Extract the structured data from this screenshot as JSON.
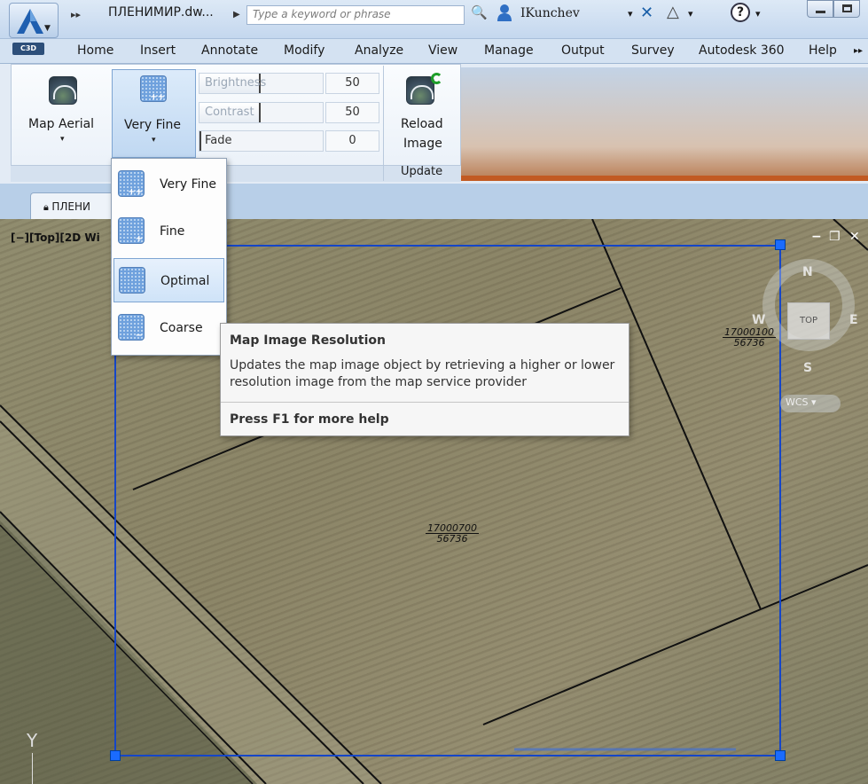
{
  "titlebar": {
    "app_badge": "C3D",
    "file_title": "ПЛЕНИМИР.dw...",
    "search_placeholder": "Type a keyword or phrase",
    "user_name": "IKunchev"
  },
  "ribbon_tabs": [
    "Home",
    "Insert",
    "Annotate",
    "Modify",
    "Analyze",
    "View",
    "Manage",
    "Output",
    "Survey",
    "Autodesk 360",
    "Help"
  ],
  "ribbon": {
    "map_aerial_label": "Map Aerial",
    "very_fine_label": "Very Fine",
    "sliders": [
      {
        "label": "Brightness",
        "value": "50",
        "fill": 0.5
      },
      {
        "label": "Contrast",
        "value": "50",
        "fill": 0.5
      },
      {
        "label": "Fade",
        "value": "0",
        "fill": 0.0
      }
    ],
    "reload_label_1": "Reload",
    "reload_label_2": "Image",
    "update_panel_label": "Update"
  },
  "file_tab": {
    "label": "ПЛЕНИ"
  },
  "viewport": {
    "label": "[−][Top][2D Wi",
    "compass": {
      "n": "N",
      "s": "S",
      "e": "E",
      "w": "W",
      "top": "TOP"
    },
    "wcs": "WCS",
    "parcels": [
      {
        "top": "17000700",
        "bottom": "56736"
      },
      {
        "top": "17000100",
        "bottom": "56736"
      }
    ],
    "y_axis": "Y"
  },
  "resolution_menu": {
    "items": [
      {
        "label": "Very Fine",
        "selected": false
      },
      {
        "label": "Fine",
        "selected": false
      },
      {
        "label": "Optimal",
        "selected": true
      },
      {
        "label": "Coarse",
        "selected": false
      }
    ]
  },
  "tooltip": {
    "title": "Map Image Resolution",
    "description": "Updates the map image object by retrieving a higher or lower resolution image from the map service provider",
    "help": "Press F1 for more help"
  },
  "colors": {
    "accent": "#1a6bff",
    "ribbon_bg": "#e3ebf5",
    "selection": "#cfe3f8"
  }
}
